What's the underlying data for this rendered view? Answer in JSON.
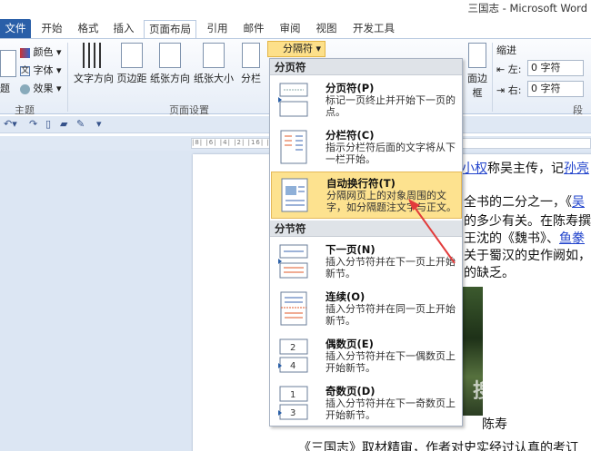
{
  "window": {
    "title": "三国志 - Microsoft Word"
  },
  "tabs": [
    {
      "label": "文件"
    },
    {
      "label": "开始"
    },
    {
      "label": "格式"
    },
    {
      "label": "插入"
    },
    {
      "label": "页面布局"
    },
    {
      "label": "引用"
    },
    {
      "label": "邮件"
    },
    {
      "label": "审阅"
    },
    {
      "label": "视图"
    },
    {
      "label": "开发工具"
    }
  ],
  "ribbon": {
    "theme_group": {
      "label": "主题",
      "colors": "颜色",
      "fonts": "字体",
      "effects": "效果",
      "theme_btn": "题"
    },
    "page_setup": {
      "label": "页面设置",
      "text_direction": "文字方向",
      "margins": "页边距",
      "orientation": "纸张方向",
      "size": "纸张大小",
      "columns": "分栏",
      "breaks": "分隔符"
    },
    "page_border": "面边框",
    "indent": {
      "label": "缩进",
      "left_label": "左:",
      "left_value": "0 字符",
      "right_label": "右:",
      "right_value": "0 字符"
    },
    "para_group_stub": "段"
  },
  "ruler": {
    "marks": "|8| |6| |4| |2|                                             |16| |18| |20| |22| |24|"
  },
  "menu": {
    "page_breaks_header": "分页符",
    "section_breaks_header": "分节符",
    "items": [
      {
        "title": "分页符(P)",
        "desc": "标记一页终止并开始下一页的点。"
      },
      {
        "title": "分栏符(C)",
        "desc": "指示分栏符后面的文字将从下一栏开始。"
      },
      {
        "title": "自动换行符(T)",
        "desc": "分隔网页上的对象周围的文字，如分隔题注文字与正文。"
      },
      {
        "title": "下一页(N)",
        "desc": "插入分节符并在下一页上开始新节。"
      },
      {
        "title": "连续(O)",
        "desc": "插入分节符并在同一页上开始新节。"
      },
      {
        "title": "偶数页(E)",
        "desc": "插入分节符并在下一偶数页上开始新节。"
      },
      {
        "title": "奇数页(D)",
        "desc": "插入分节符并在下一奇数页上开始新节。"
      }
    ]
  },
  "document": {
    "line1_pre": "小权",
    "line1_mid": "称吴主传，记",
    "line1_link2": "孙亮",
    "line2": "全书的二分之一，《",
    "line2_link": "吴",
    "line3": "的多少有关。在陈寿撰",
    "line4_pre": "王沈的《魏书》、",
    "line4_link": "鱼豢",
    "line5": "关于蜀汉的史作阙如，",
    "line6": "的缺乏。",
    "caption": "陈寿",
    "bottom": "《三国志》取材精审，作者对史实经过认真的考订"
  },
  "watermark": "搜狗指南"
}
